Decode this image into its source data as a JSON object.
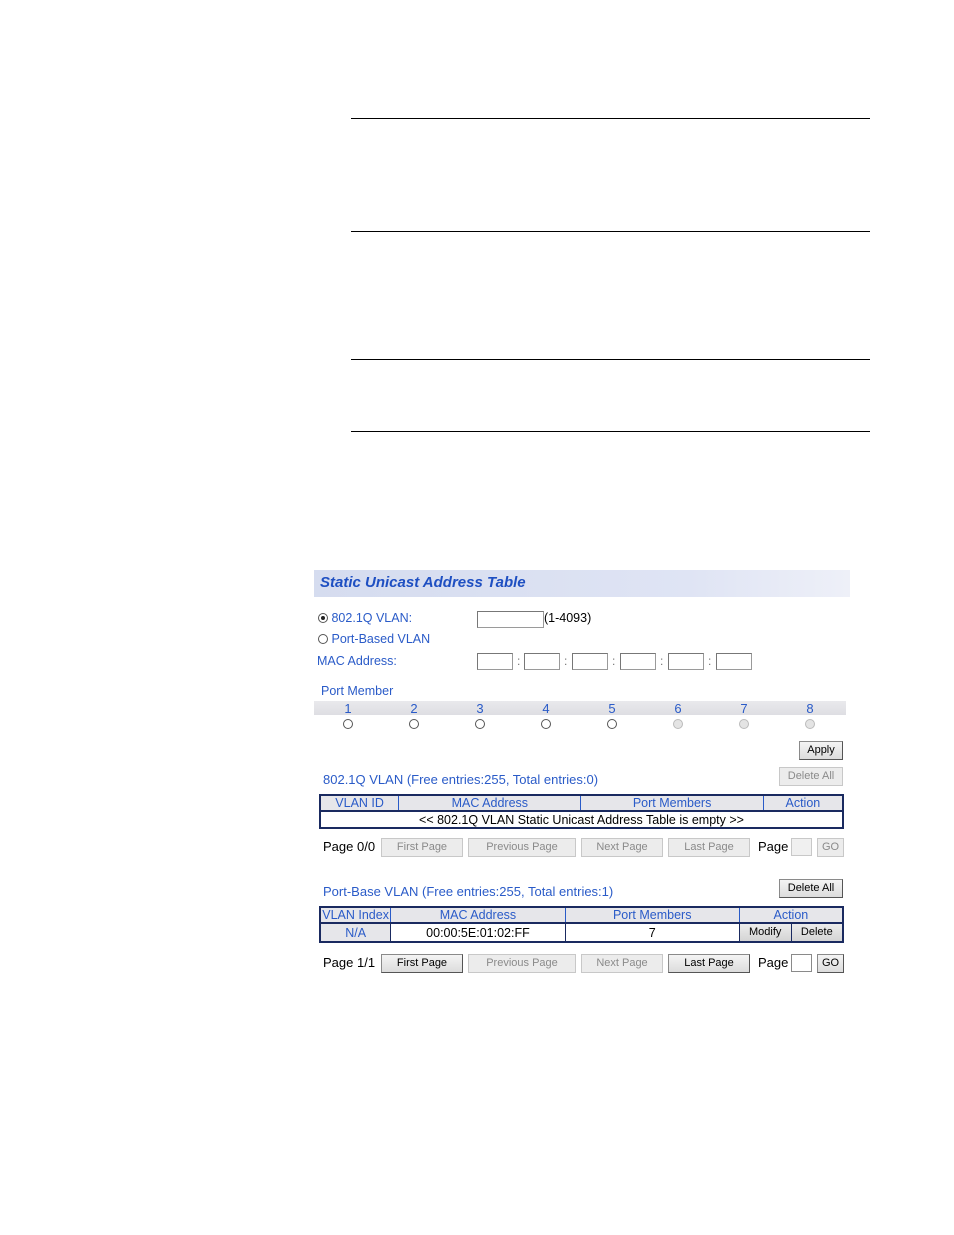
{
  "panel": {
    "title": "Static Unicast Address Table",
    "vlan_mode": {
      "options": [
        {
          "label": "802.1Q VLAN:",
          "checked": true
        },
        {
          "label": "Port-Based VLAN",
          "checked": false
        }
      ],
      "vlan_id_value": "",
      "vlan_id_range": "(1-4093)"
    },
    "mac_address": {
      "label": "MAC Address:",
      "octets": [
        "",
        "",
        "",
        "",
        "",
        ""
      ],
      "separator": ":"
    },
    "port_member": {
      "label": "Port Member",
      "ports": [
        {
          "number": "1",
          "enabled": true,
          "checked": false
        },
        {
          "number": "2",
          "enabled": true,
          "checked": false
        },
        {
          "number": "3",
          "enabled": true,
          "checked": false
        },
        {
          "number": "4",
          "enabled": true,
          "checked": false
        },
        {
          "number": "5",
          "enabled": true,
          "checked": false
        },
        {
          "number": "6",
          "enabled": false,
          "checked": false
        },
        {
          "number": "7",
          "enabled": false,
          "checked": false
        },
        {
          "number": "8",
          "enabled": false,
          "checked": false
        }
      ]
    },
    "apply_label": "Apply",
    "dot1q_table": {
      "summary": "802.1Q VLAN (Free entries:255, Total entries:0)",
      "delete_all_label": "Delete All",
      "delete_all_enabled": false,
      "columns": [
        "VLAN ID",
        "MAC Address",
        "Port Members",
        "Action"
      ],
      "empty_message": "<< 802.1Q VLAN Static Unicast Address Table is empty >>",
      "pager": {
        "page_status": "Page 0/0",
        "first": "First Page",
        "previous": "Previous Page",
        "next": "Next Page",
        "last": "Last Page",
        "page_label": "Page",
        "page_value": "",
        "go": "GO"
      }
    },
    "port_table": {
      "summary": "Port-Base VLAN (Free entries:255, Total entries:1)",
      "delete_all_label": "Delete All",
      "delete_all_enabled": true,
      "columns": [
        "VLAN Index",
        "MAC Address",
        "Port Members",
        "Action"
      ],
      "rows": [
        {
          "vlan_index": "N/A",
          "mac": "00:00:5E:01:02:FF",
          "ports": "7",
          "modify": "Modify",
          "delete": "Delete"
        }
      ],
      "pager": {
        "page_status": "Page 1/1",
        "first": "First Page",
        "previous": "Previous Page",
        "next": "Next Page",
        "last": "Last Page",
        "page_label": "Page",
        "page_value": "",
        "go": "GO"
      }
    }
  }
}
